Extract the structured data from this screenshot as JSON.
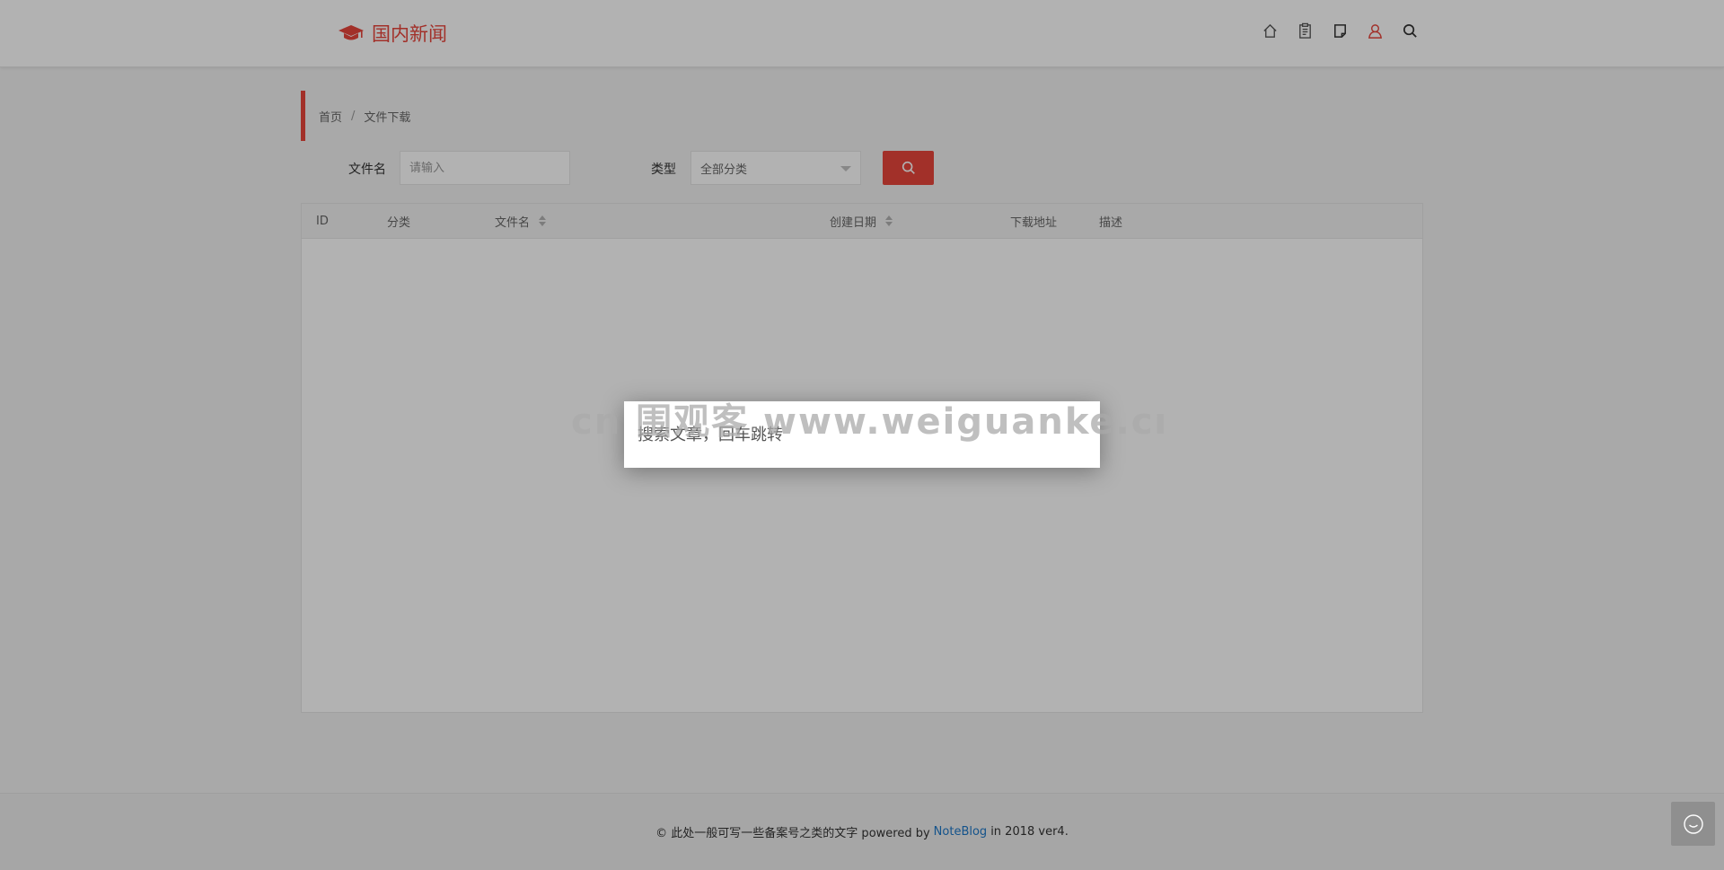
{
  "header": {
    "site_title": "国内新闻",
    "nav_icons": [
      "home-icon",
      "clipboard-icon",
      "note-icon",
      "user-icon",
      "search-icon"
    ],
    "accent_color": "#e8453c"
  },
  "breadcrumb": {
    "home": "首页",
    "separator": "/",
    "current": "文件下载"
  },
  "filters": {
    "filename_label": "文件名",
    "filename_placeholder": "请输入",
    "type_label": "类型",
    "type_selected": "全部分类",
    "search_button_icon": "search-icon"
  },
  "table": {
    "columns": [
      "ID",
      "分类",
      "文件名",
      "创建日期",
      "下载地址",
      "描述"
    ],
    "rows": []
  },
  "footer": {
    "copyright": "© 此处一般可写一些备案号之类的文字 powered by",
    "link_text": "NoteBlog",
    "suffix": "in 2018 ver4."
  },
  "dialog": {
    "search_placeholder": "搜索文章，回车跳转"
  },
  "watermark": {
    "text": "cn 围观客 www.weiguanke.cn"
  },
  "colors": {
    "accent": "#e8453c",
    "link": "#1e78c8",
    "header_bg": "#ffffff",
    "table_header_bg": "#f2f2f2"
  }
}
